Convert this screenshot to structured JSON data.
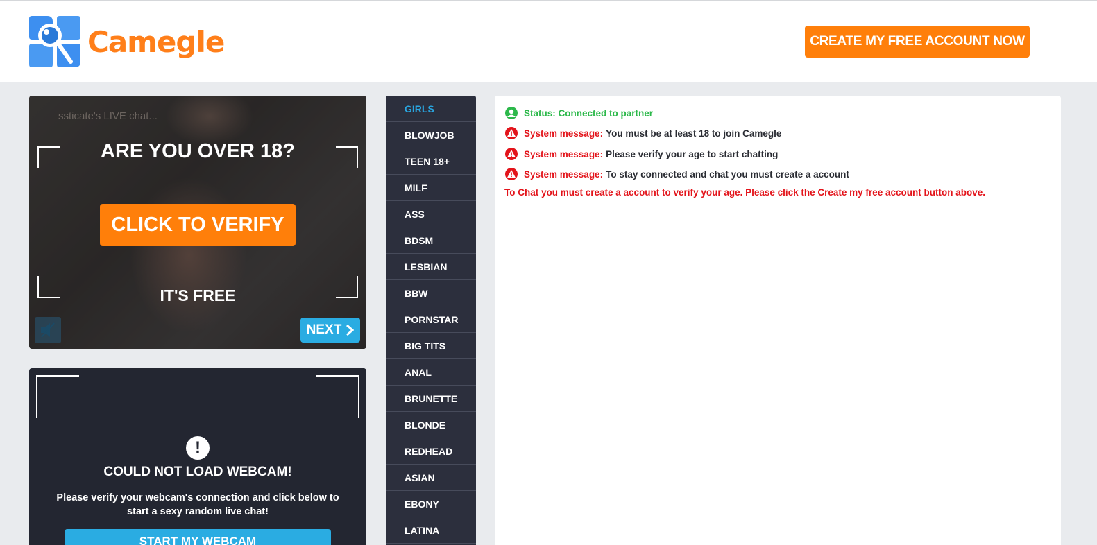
{
  "header": {
    "logo_text": "Camegle",
    "cta_label": "CREATE MY FREE ACCOUNT NOW"
  },
  "video": {
    "caption": "ssticate's LIVE chat...",
    "headline": "ARE YOU OVER 18?",
    "verify_label": "CLICK TO VERIFY",
    "free_label": "IT'S FREE",
    "next_label": "NEXT",
    "mute_icon": "speaker-muted-icon"
  },
  "webcam": {
    "title": "COULD NOT LOAD WEBCAM!",
    "text": "Please verify your webcam's connection and click below to start a sexy random live chat!",
    "button_label": "START MY WEBCAM"
  },
  "categories": {
    "items": [
      {
        "label": "GIRLS"
      },
      {
        "label": "BLOWJOB"
      },
      {
        "label": "TEEN 18+"
      },
      {
        "label": "MILF"
      },
      {
        "label": "ASS"
      },
      {
        "label": "BDSM"
      },
      {
        "label": "LESBIAN"
      },
      {
        "label": "BBW"
      },
      {
        "label": "PORNSTAR"
      },
      {
        "label": "BIG TITS"
      },
      {
        "label": "ANAL"
      },
      {
        "label": "BRUNETTE"
      },
      {
        "label": "BLONDE"
      },
      {
        "label": "REDHEAD"
      },
      {
        "label": "ASIAN"
      },
      {
        "label": "EBONY"
      },
      {
        "label": "LATINA"
      }
    ]
  },
  "chat": {
    "status": "Status: Connected to partner",
    "system_prefix": "System message:",
    "messages": [
      {
        "text": "You must be at least 18 to join Camegle"
      },
      {
        "text": "Please verify your age to start chatting"
      },
      {
        "text": "To stay connected and chat you must create a account"
      }
    ],
    "notice": "To Chat you must create a account to verify your age. Please click the Create my free account button above."
  },
  "colors": {
    "accent_orange": "#ff7f0a",
    "accent_blue": "#2aace2",
    "status_green": "#2cb84a",
    "alert_red": "#e3141b",
    "panel_dark": "#2c2f3d"
  }
}
